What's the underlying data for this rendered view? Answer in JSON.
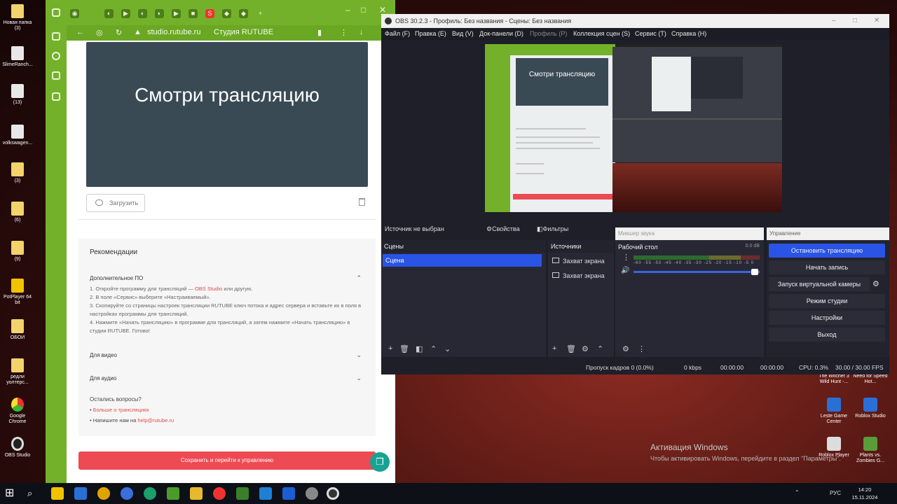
{
  "desktop": {
    "icons": [
      {
        "label": "Новая папка (3)"
      },
      {
        "label": "SlimeRanch..."
      },
      {
        "label": "(13)"
      },
      {
        "label": "volkswagen..."
      },
      {
        "label": "(3)"
      },
      {
        "label": "(6)"
      },
      {
        "label": "(9)"
      },
      {
        "label": "PotPlayer 64 bit"
      },
      {
        "label": "ОБОИ"
      },
      {
        "label": "редли уолтерс..."
      },
      {
        "label": "Google Chrome"
      },
      {
        "label": "OBS Studio"
      }
    ],
    "right_icons": [
      {
        "label": "The Witcher 3 Wild Hunt -..."
      },
      {
        "label": "Need for Speed Hot..."
      },
      {
        "label": "Leste Game Center"
      },
      {
        "label": "Roblox Studio"
      },
      {
        "label": "Roblox Player"
      },
      {
        "label": "Plants vs. Zombies G..."
      }
    ],
    "watermark_title": "Активация Windows",
    "watermark_text": "Чтобы активировать Windows, перейдите в раздел \"Параметры\"."
  },
  "browser": {
    "url": "studio.rutube.ru",
    "page_title": "Студия RUTUBE",
    "banner_title": "Смотри трансляцию",
    "upload_label": "Загрузить",
    "recs": {
      "title": "Рекомендации",
      "section1": "Дополнительное ПО",
      "step1_a": "1. Откройте программу для трансляций — ",
      "step1_link": "OBS Studio",
      "step1_b": " или другую.",
      "step2": "2. В поле «Сервис» выберите «Настраиваемый».",
      "step3": "3. Скопируйте со страницы настроек трансляции RUTUBE ключ потока и адрес сервера и вставьте их в поля в настройках программы для трансляций.",
      "step4": "4. Нажмите «Начать трансляцию» в программе для трансляций, а затем нажмите «Начать трансляцию» в студии RUTUBE. Готово!",
      "section2": "Для видео",
      "section3": "Для аудио",
      "questions": "Остались вопросы?",
      "q1_link": "Больше о трансляциях",
      "q2": "Напишите нам на ",
      "q2_link": "help@rutube.ru"
    },
    "save_button": "Сохранить и перейти к управлению"
  },
  "obs": {
    "title": "OBS 30.2.3 - Профиль: Без названия - Сцены: Без названия",
    "menu": [
      "Файл (F)",
      "Правка (E)",
      "Вид (V)",
      "Док-панели (D)",
      "Профиль (P)",
      "Коллекция сцен (S)",
      "Сервис (T)",
      "Справка (H)"
    ],
    "preview_text": "Смотри трансляцию",
    "no_source": "Источник не выбран",
    "properties": "Свойства",
    "filters": "Фильтры",
    "scenes_title": "Сцены",
    "scene_item": "Сцена",
    "sources_title": "Источники",
    "sources": [
      "Захват экрана",
      "Захват экрана"
    ],
    "mixer_title": "Микшер звука",
    "track_name": "Рабочий стол",
    "track_db": "0.0 dB",
    "scale": "-60 -55 -50 -45 -40 -35 -30 -25 -20 -15 -10 -5 0",
    "volume_level": 0.93,
    "controls_title": "Управление",
    "controls": [
      "Остановить трансляцию",
      "Начать запись",
      "Запуск виртуальной камеры",
      "Режим студии",
      "Настройки",
      "Выход"
    ],
    "status": {
      "dropped": "Пропуск кадров 0 (0.0%)",
      "kbps": "0 kbps",
      "stream_time": "00:00:00",
      "rec_time": "00:00:00",
      "cpu": "CPU: 0.3%",
      "fps": "30.00 / 30.00 FPS"
    }
  },
  "taskbar": {
    "lang": "РУС",
    "time": "14:20",
    "date": "15.11.2024"
  }
}
